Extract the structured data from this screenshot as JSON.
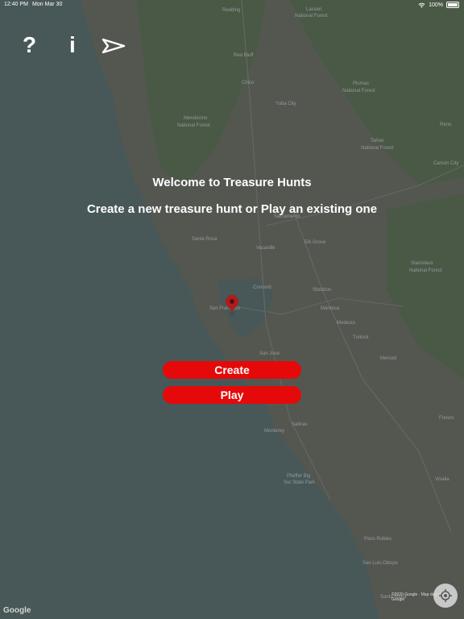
{
  "status_bar": {
    "time": "12:40 PM",
    "date": "Mon Mar 30",
    "battery": "100%"
  },
  "toolbar": {
    "help_icon": "question-mark-icon",
    "info_icon": "info-icon",
    "nav_icon": "navigation-arrow-icon"
  },
  "welcome": {
    "title": "Welcome to Treasure Hunts",
    "subtitle": "Create a new treasure hunt or Play an existing one"
  },
  "buttons": {
    "create": "Create",
    "play": "Play"
  },
  "map": {
    "attribution": "Google",
    "credit": "©2020 Google · Map data ©2020 Google",
    "labels": {
      "redding": "Redding",
      "lassen": "Lassen",
      "national_forest_1": "National Forest",
      "red_bluff": "Red Bluff",
      "chico": "Chico",
      "plumas": "Plumas",
      "national_forest_2": "National Forest",
      "mendocino": "Mendocino",
      "national_forest_3": "National Forest",
      "yuba_city": "Yuba City",
      "tahoe": "Tahoe",
      "national_forest_4": "National Forest",
      "reno": "Reno",
      "carson_city": "Carson City",
      "sacramento": "Sacramento",
      "santa_rosa": "Santa Rosa",
      "vacaville": "Vacaville",
      "elk_grove": "Elk Grove",
      "concord": "Concord",
      "stockton": "Stockton",
      "stanislaus": "Stanislaus",
      "national_forest_5": "National Forest",
      "san_francisco": "San Francisco",
      "manteca": "Manteca",
      "modesto": "Modesto",
      "turlock": "Turlock",
      "san_jose": "San Jose",
      "merced": "Merced",
      "salinas": "Salinas",
      "fresno": "Fresno",
      "monterey": "Monterey",
      "pfeiffer_big": "Pfeiffer Big",
      "sur_state_park": "Sur State Park",
      "visalia": "Visalia",
      "paso_robles": "Paso Robles",
      "san_luis_obispo": "San Luis Obispo",
      "santa_maria": "Santa Maria"
    },
    "colors": {
      "ocean": "#5c7476",
      "land": "#6e7569",
      "forest": "#5f7659",
      "button": "#e50909",
      "pin": "#b01b1b"
    }
  }
}
